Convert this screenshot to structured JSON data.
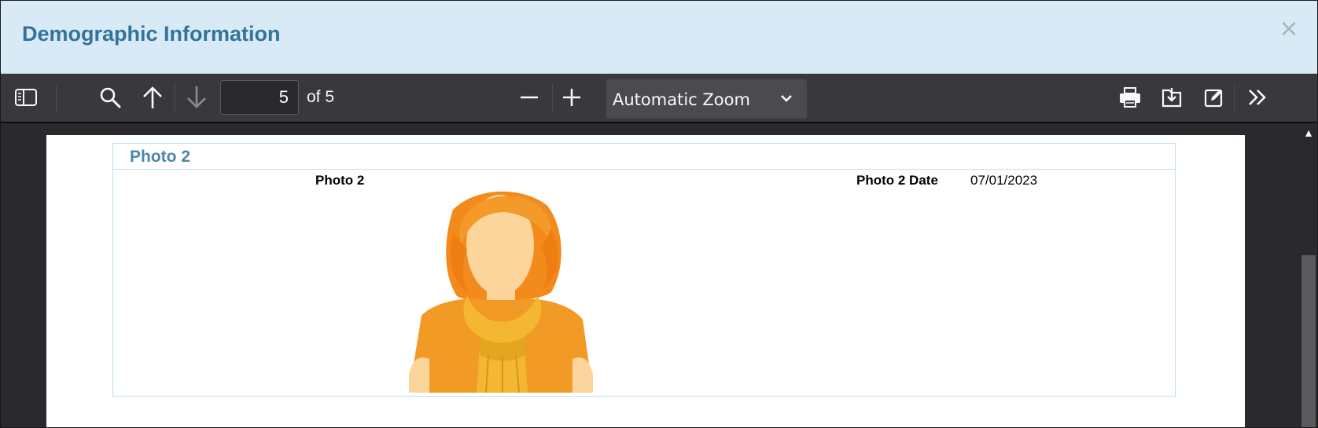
{
  "modal": {
    "title": "Demographic Information",
    "close_label": "×"
  },
  "toolbar": {
    "page_number": "5",
    "page_of": "of 5",
    "zoom_label": "Automatic Zoom",
    "icons": [
      "sidebar-toggle-icon",
      "search-icon",
      "previous-page-icon",
      "next-page-icon",
      "zoom-out-icon",
      "zoom-in-icon",
      "print-icon",
      "download-icon",
      "edit-icon",
      "more-tools-icon"
    ]
  },
  "document": {
    "section_title": "Photo 2",
    "photo_label": "Photo 2",
    "photo_date_label": "Photo 2 Date",
    "photo_date_value": "07/01/2023"
  },
  "colors": {
    "header_bg": "#d8eaf5",
    "title": "#34729a",
    "toolbar_bg": "#38383d",
    "section_border": "#b9e0ee",
    "hair": "#f28a1c",
    "shirt": "#f29a26",
    "scarf": "#f4b731"
  }
}
